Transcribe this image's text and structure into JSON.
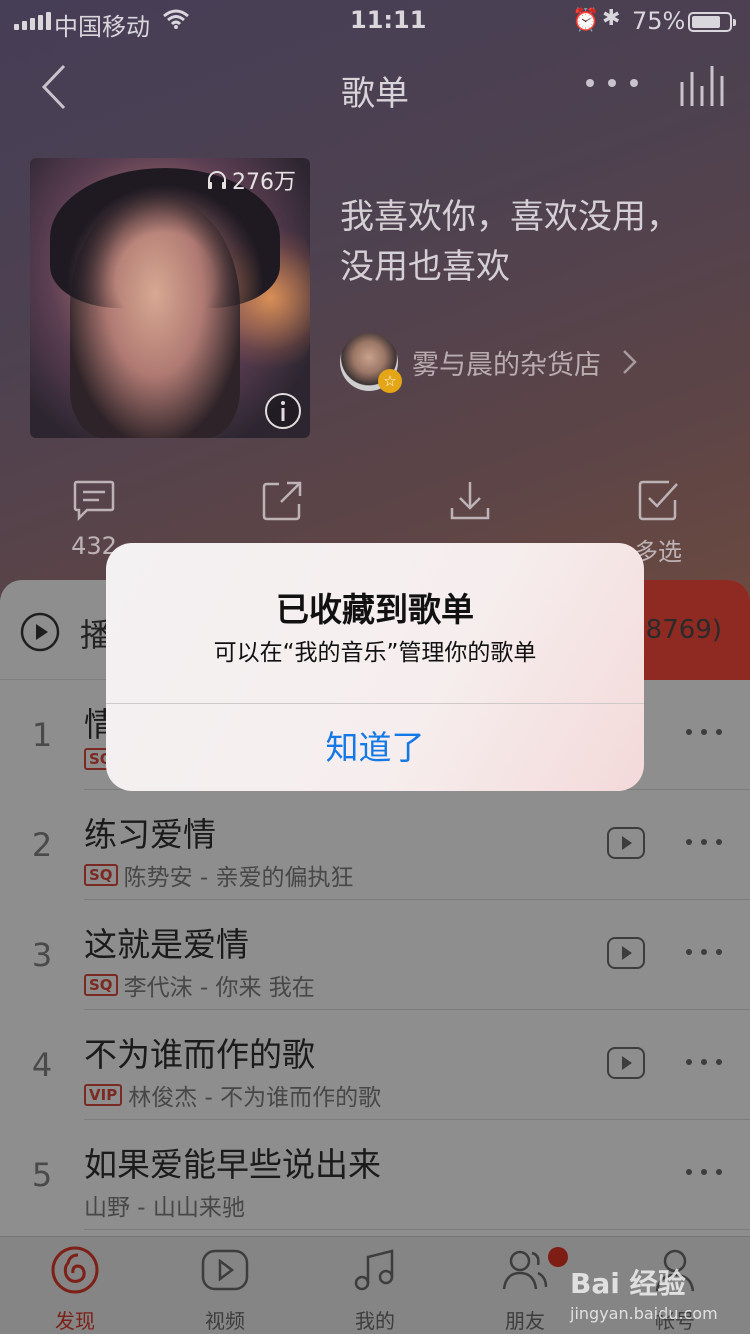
{
  "status_bar": {
    "carrier": "中国移动",
    "time": "11:11",
    "battery_percent": "75%"
  },
  "nav": {
    "title": "歌单"
  },
  "playlist": {
    "play_count": "276万",
    "title_line1": "我喜欢你，喜欢没用，",
    "title_line2": "没用也喜欢",
    "creator_name": "雾与晨的杂货店"
  },
  "actions": {
    "comment_count": "432",
    "multi_select": "多选"
  },
  "list_header": {
    "play_all_label": "播",
    "collect_count": "28769)"
  },
  "songs": [
    {
      "index": "1",
      "title": "情",
      "badge": "SQ",
      "subtitle": ""
    },
    {
      "index": "2",
      "title": "练习爱情",
      "badge": "SQ",
      "subtitle": "陈势安 - 亲爱的偏执狂"
    },
    {
      "index": "3",
      "title": "这就是爱情",
      "badge": "SQ",
      "subtitle": "李代沫 - 你来 我在"
    },
    {
      "index": "4",
      "title": "不为谁而作的歌",
      "badge": "VIP",
      "subtitle": "林俊杰 - 不为谁而作的歌"
    },
    {
      "index": "5",
      "title": "如果爱能早些说出来",
      "badge": "",
      "subtitle": "山野 - 山山来驰"
    }
  ],
  "tabbar": [
    {
      "label": "发现"
    },
    {
      "label": "视频"
    },
    {
      "label": "我的"
    },
    {
      "label": "朋友"
    },
    {
      "label": "帐号"
    }
  ],
  "dialog": {
    "title": "已收藏到歌单",
    "message": "可以在“我的音乐”管理你的歌单",
    "button": "知道了"
  },
  "watermark": {
    "brand": "Bai 经验",
    "url": "jingyan.baidu.com"
  },
  "colors": {
    "accent_red": "#8f2a22",
    "dialog_button_blue": "#1478e6"
  }
}
